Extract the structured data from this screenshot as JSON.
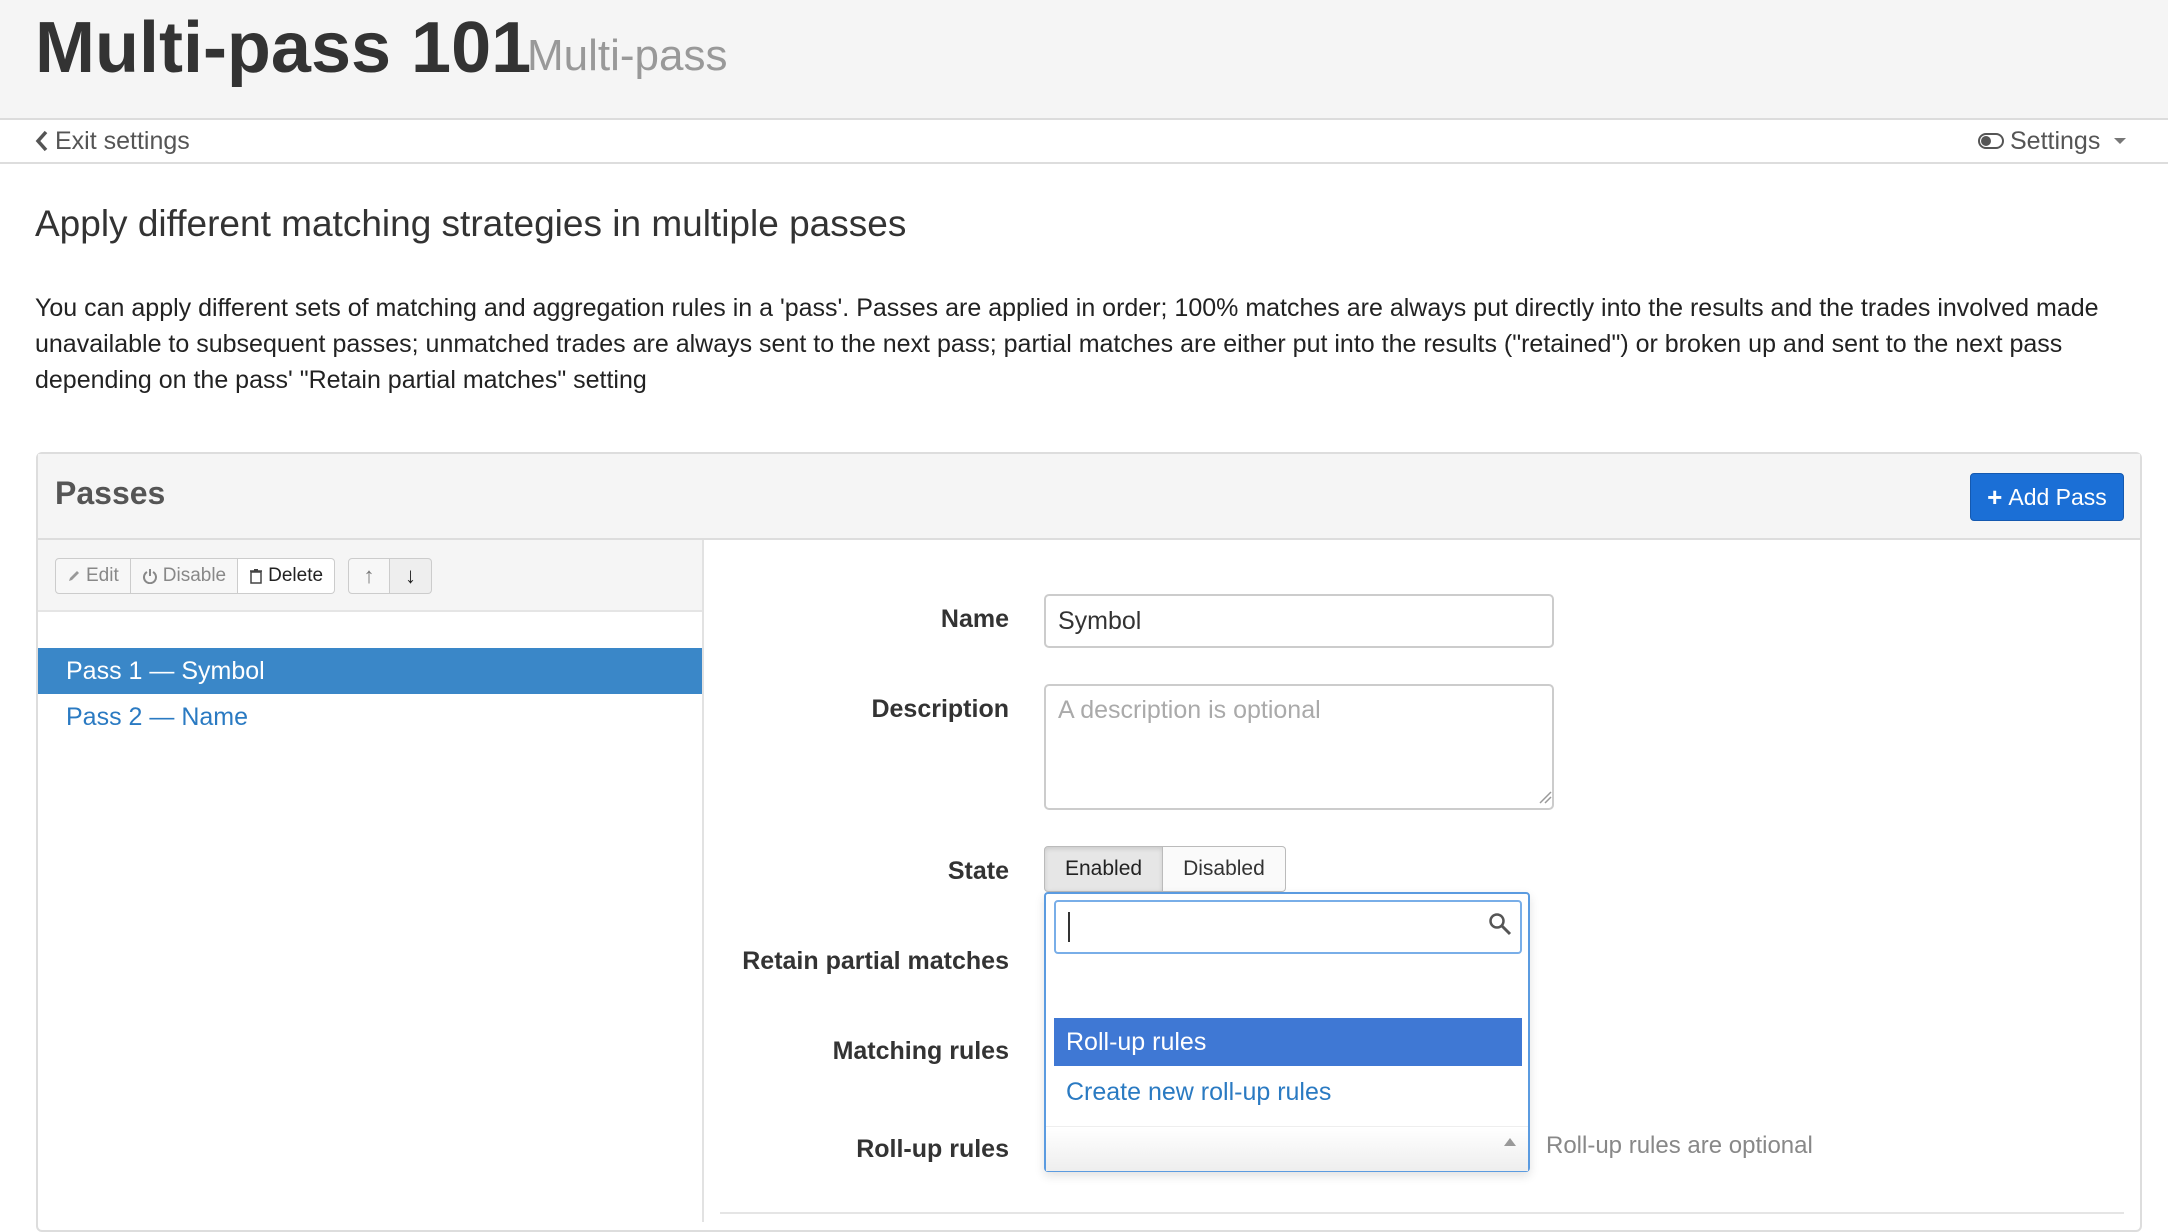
{
  "header": {
    "title": "Multi-pass 101",
    "subtitle": "Multi-pass"
  },
  "subnav": {
    "exit_label": "Exit settings",
    "settings_label": "Settings"
  },
  "section": {
    "heading": "Apply different matching strategies in multiple passes",
    "intro": "You can apply different sets of matching and aggregation rules in a 'pass'. Passes are applied in order; 100% matches are always put directly into the results and the trades involved made unavailable to subsequent passes; unmatched trades are always sent to the next pass; partial matches are either put into the results (\"retained\") or broken up and sent to the next pass depending on the pass' \"Retain partial matches\" setting"
  },
  "panel": {
    "title": "Passes",
    "add_button": "Add Pass",
    "toolbar": {
      "edit": "Edit",
      "disable": "Disable",
      "delete": "Delete"
    },
    "passes": [
      {
        "label": "Pass 1  — Symbol",
        "selected": true
      },
      {
        "label": "Pass 2  — Name",
        "selected": false
      }
    ]
  },
  "form": {
    "name_label": "Name",
    "name_value": "Symbol",
    "description_label": "Description",
    "description_placeholder": "A description is optional",
    "state_label": "State",
    "state_options": [
      "Enabled",
      "Disabled"
    ],
    "state_selected": "Enabled",
    "retain_label": "Retain partial matches",
    "matching_label": "Matching rules",
    "rollup_label": "Roll-up rules",
    "rollup_hint": "Roll-up rules are optional"
  },
  "dropdown": {
    "search_value": "",
    "options": [
      "Roll-up rules",
      "Create new roll-up rules"
    ],
    "highlighted": "Roll-up rules"
  },
  "colors": {
    "primary": "#1b6fd6",
    "selected_row": "#3a87c8",
    "link": "#2a7ac2",
    "dropdown_highlight": "#3f78d4"
  }
}
